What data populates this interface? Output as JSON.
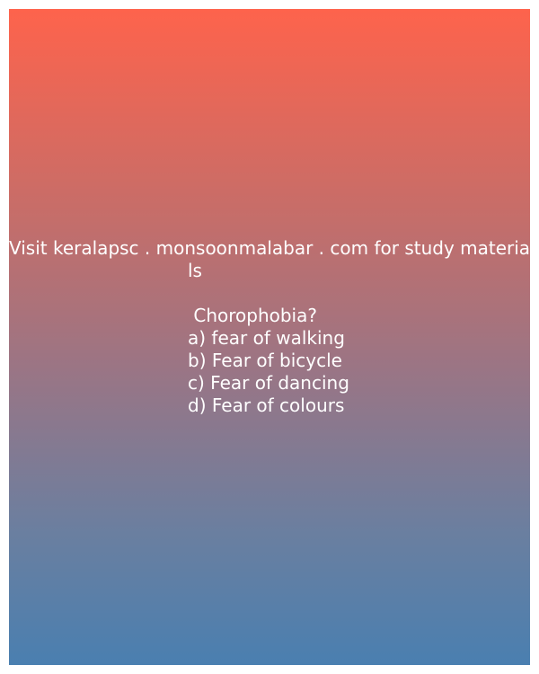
{
  "image": {
    "header_line1": "Visit keralapsc . monsoonmalabar . com for study materia",
    "header_line2": "ls",
    "question": " Chorophobia?",
    "options": [
      "a) fear of walking",
      "b) Fear of bicycle",
      "c) Fear of dancing",
      "d) Fear of colours"
    ],
    "colors": {
      "gradient_top": "#fe634c",
      "gradient_bottom": "#4a7fb0",
      "text": "#ffffff"
    }
  }
}
